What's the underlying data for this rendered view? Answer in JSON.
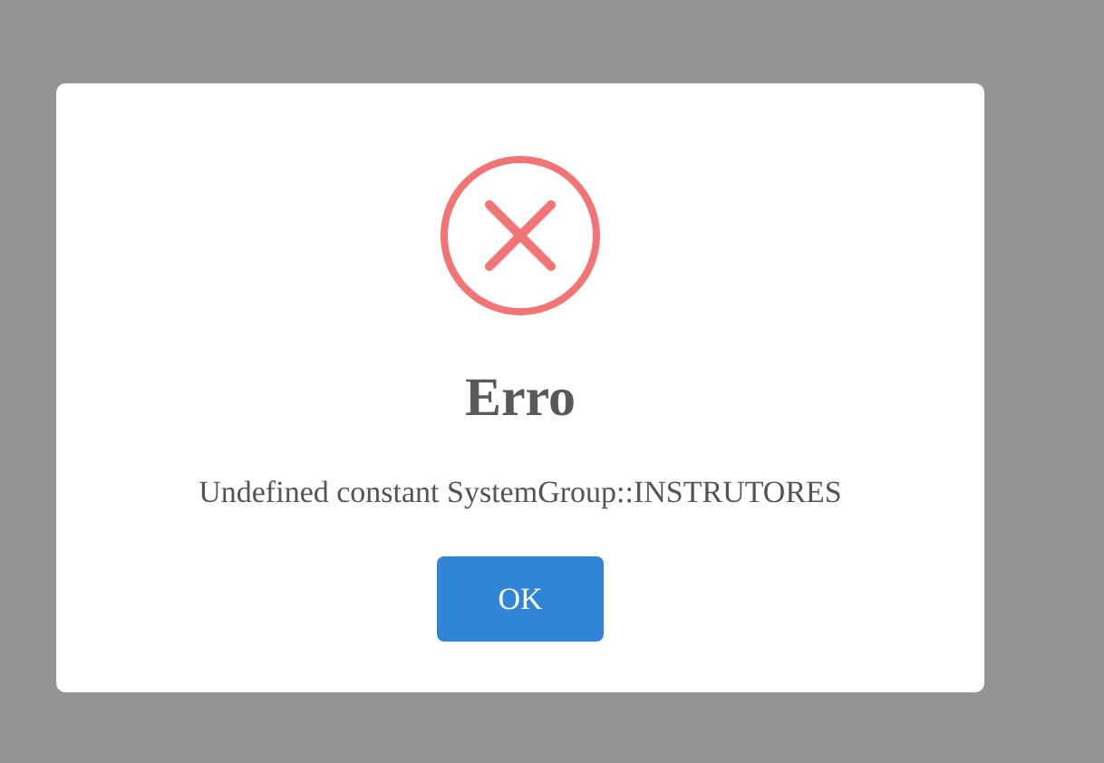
{
  "dialog": {
    "kind": "error",
    "title": "Erro",
    "message": "Undefined constant SystemGroup::INSTRUTORES",
    "buttons": [
      "OK"
    ]
  }
}
